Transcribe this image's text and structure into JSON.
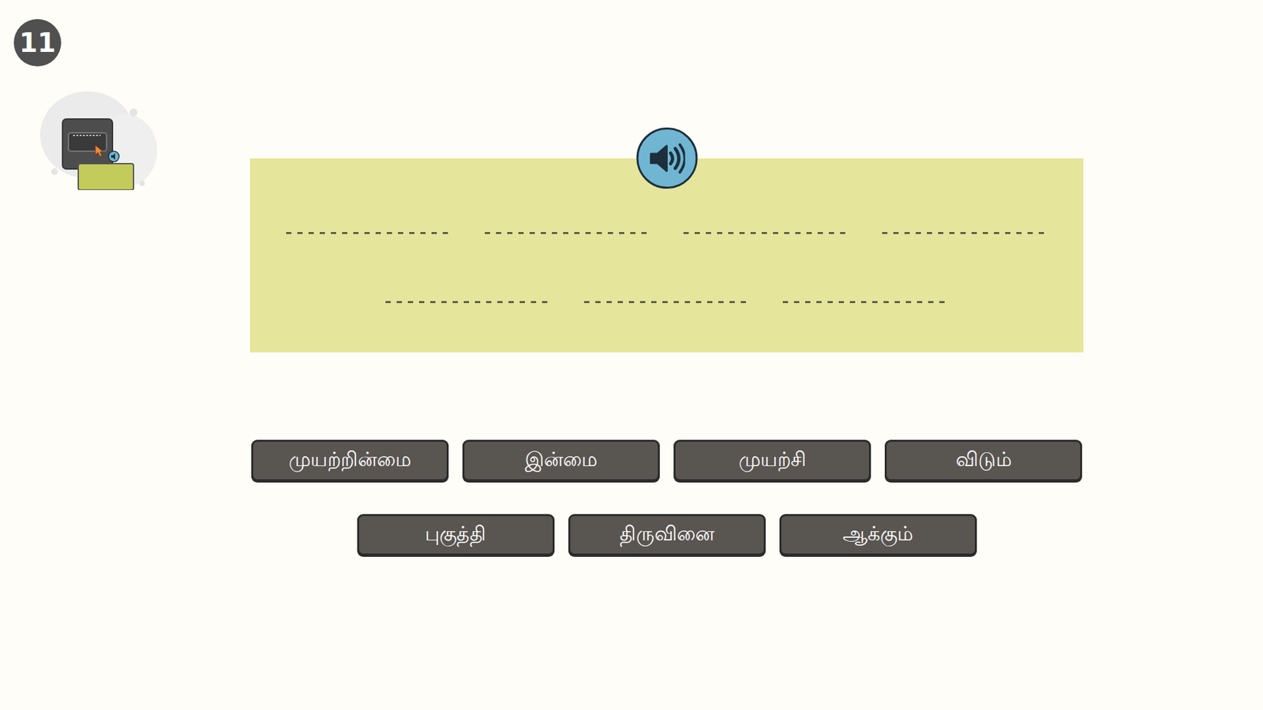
{
  "question": {
    "number": "11"
  },
  "answer_slots": [
    {
      "filled": false
    },
    {
      "filled": false
    },
    {
      "filled": false
    },
    {
      "filled": false
    },
    {
      "filled": false
    },
    {
      "filled": false
    },
    {
      "filled": false
    }
  ],
  "words": [
    {
      "text": "முயற்றின்மை"
    },
    {
      "text": "இன்மை"
    },
    {
      "text": "முயற்சி"
    },
    {
      "text": "விடும்"
    },
    {
      "text": "புகுத்தி"
    },
    {
      "text": "திருவினை"
    },
    {
      "text": "ஆக்கும்"
    }
  ]
}
